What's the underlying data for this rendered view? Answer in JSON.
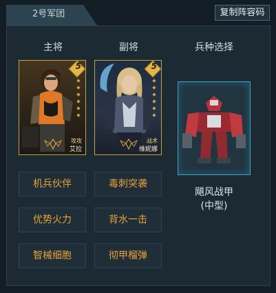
{
  "tab": {
    "label": "2号军团"
  },
  "header": {
    "copy_button": "复制阵容码"
  },
  "columns": {
    "main": "主将",
    "deputy": "副将",
    "unit": "兵种选择"
  },
  "main_general": {
    "stars": "5",
    "class": "攻攻",
    "name": "艾拉"
  },
  "deputy_general": {
    "stars": "5",
    "class": "战术",
    "name": "维妮娜"
  },
  "unit": {
    "name_line1": "飓风战甲",
    "name_line2": "(中型)"
  },
  "skills": [
    {
      "label": "机兵伙伴"
    },
    {
      "label": "毒刺突袭"
    },
    {
      "label": "优势火力"
    },
    {
      "label": "背水一击"
    },
    {
      "label": "智械细胞"
    },
    {
      "label": "彻甲榴弹"
    }
  ],
  "colors": {
    "accent": "#e8a23b",
    "card_border": "#c8a33f",
    "unit_border": "#3da3c9"
  }
}
